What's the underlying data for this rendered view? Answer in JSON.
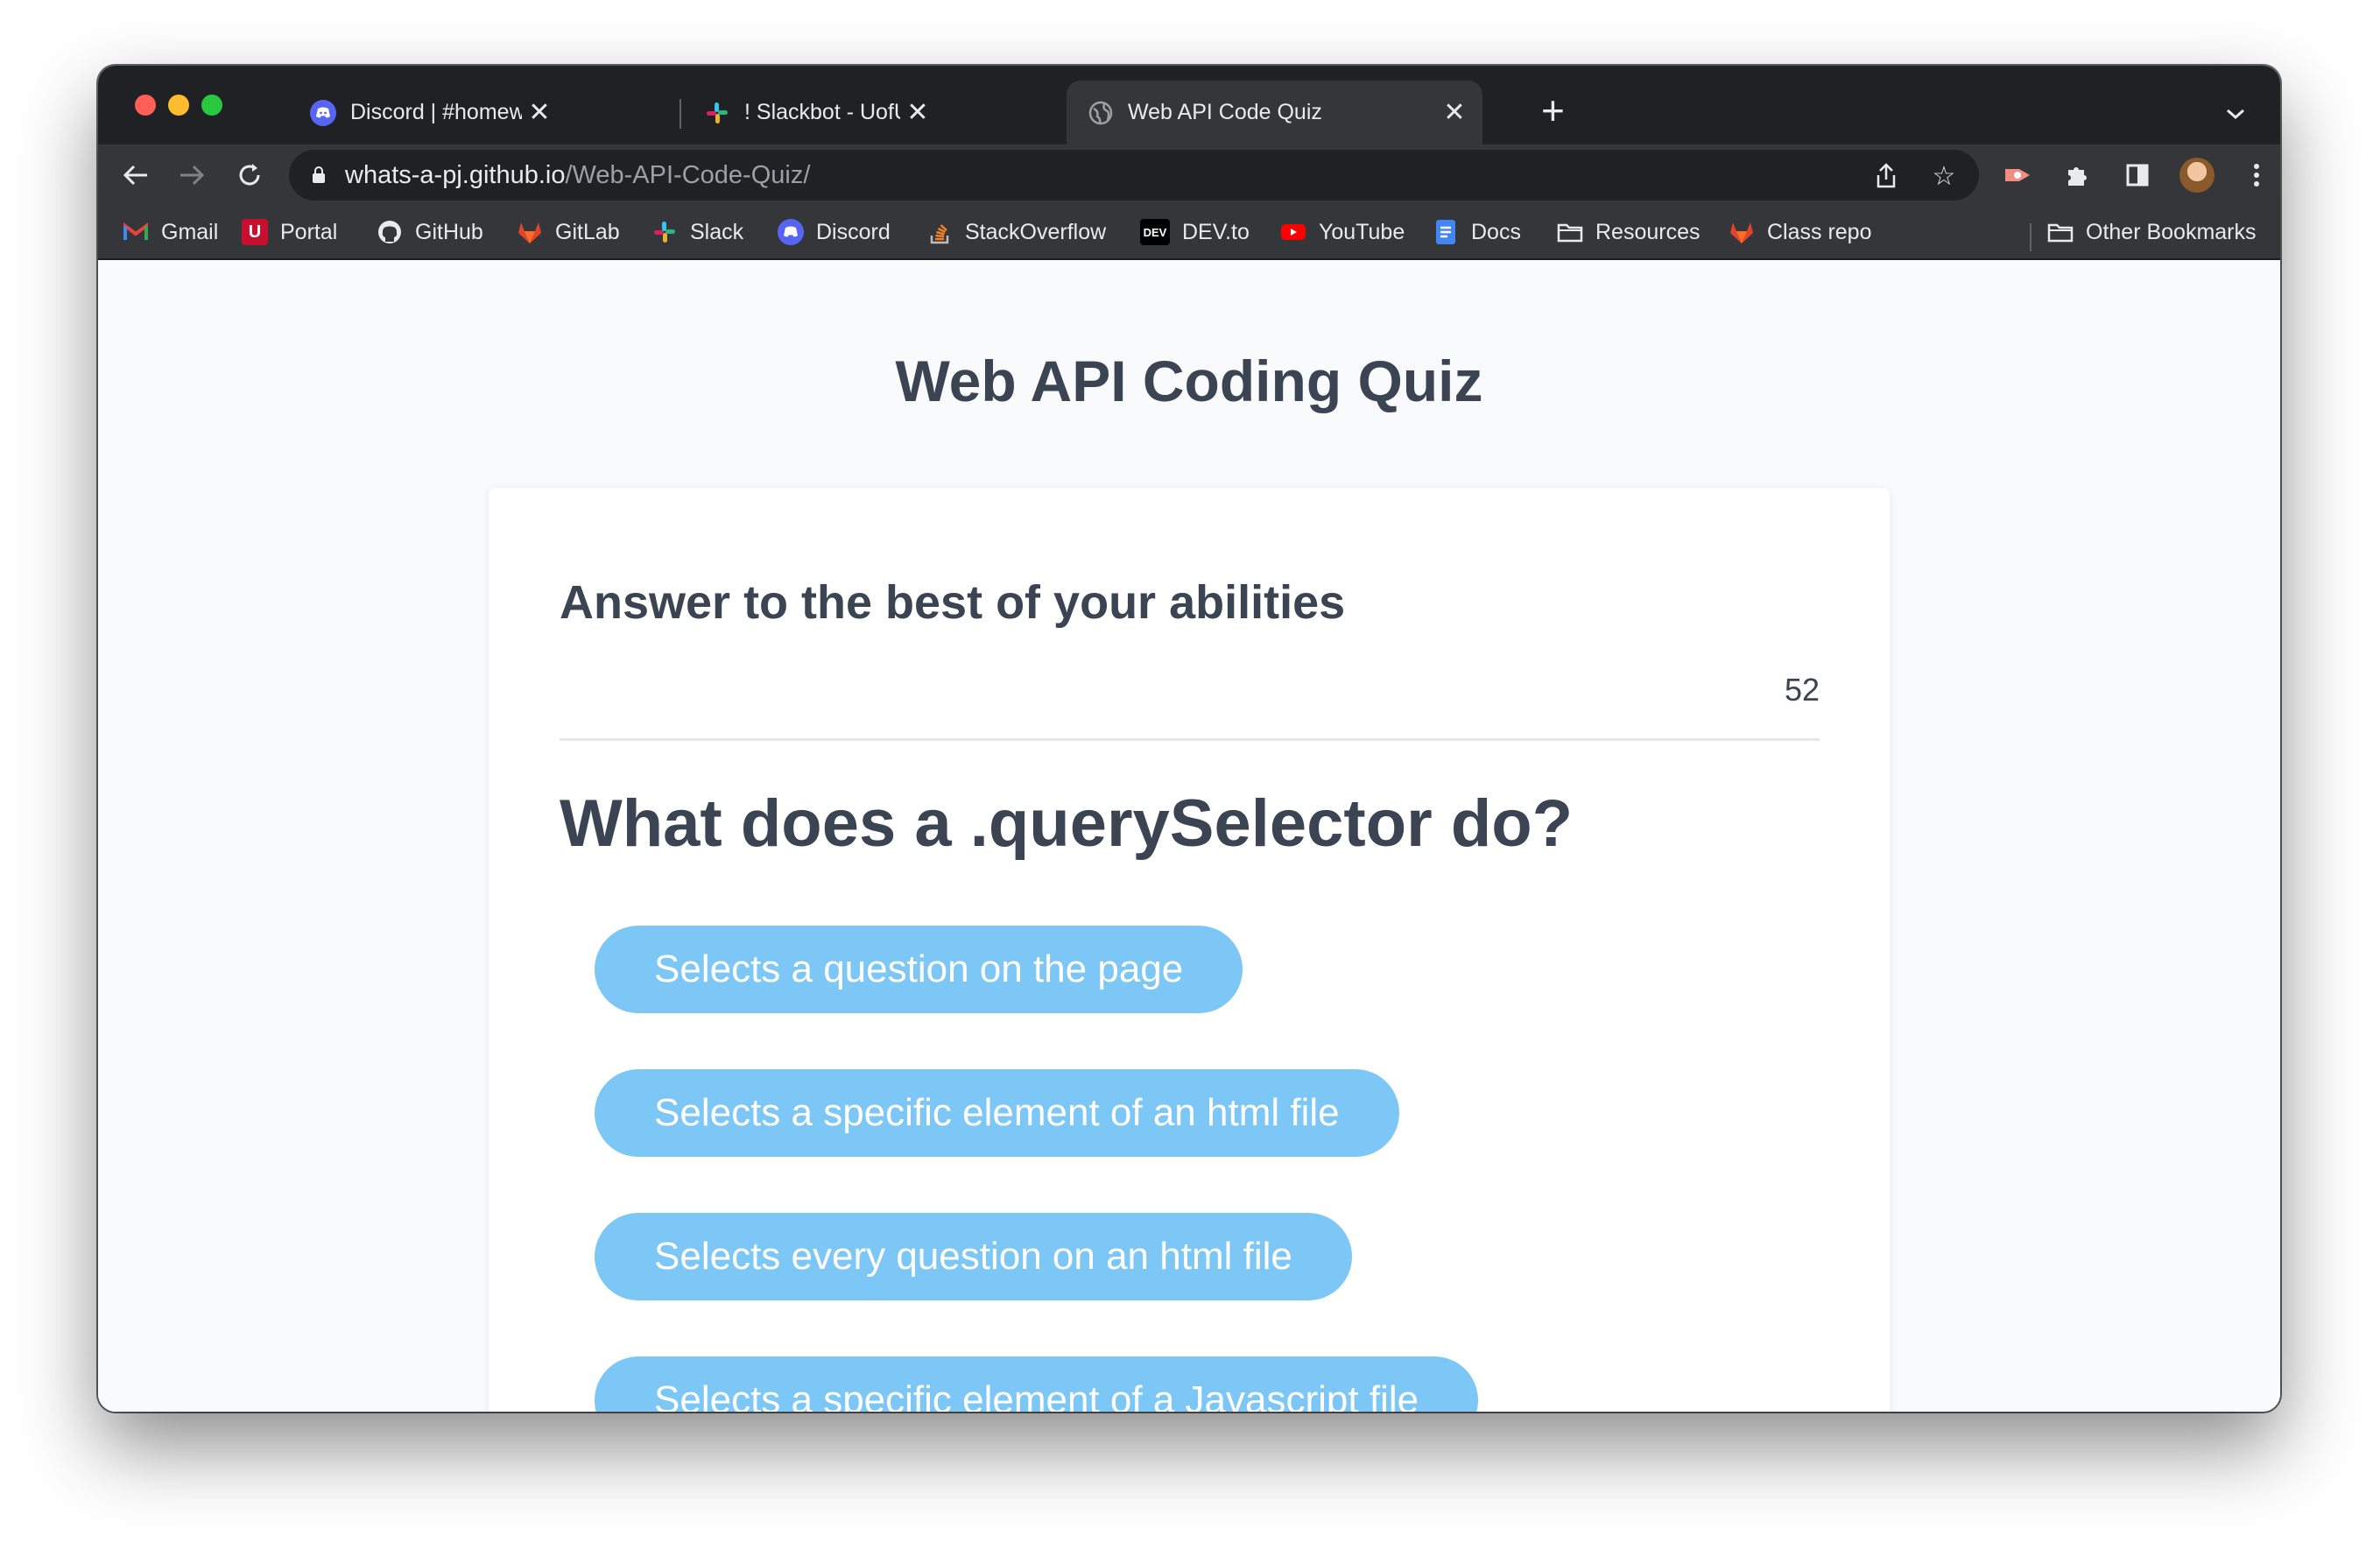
{
  "browser": {
    "tabs": [
      {
        "title": "Discord | #homework-help | Uo",
        "icon": "discord-icon",
        "active": false
      },
      {
        "title": "! Slackbot - UofU-VIRT-FSF-PT",
        "icon": "slack-icon",
        "active": false
      },
      {
        "title": "Web API Code Quiz",
        "icon": "globe-icon",
        "active": true
      }
    ],
    "address": {
      "host": "whats-a-pj.github.io",
      "path": "/Web-API-Code-Quiz/"
    },
    "bookmarks": [
      {
        "label": "Gmail",
        "icon": "gmail-icon",
        "color": "#ea4335"
      },
      {
        "label": "Portal",
        "icon": "portal-icon",
        "color": "#c8102e"
      },
      {
        "label": "GitHub",
        "icon": "github-icon",
        "color": "#ffffff"
      },
      {
        "label": "GitLab",
        "icon": "gitlab-icon",
        "color": "#e24329"
      },
      {
        "label": "Slack",
        "icon": "slack-icon",
        "color": "#36c5f0"
      },
      {
        "label": "Discord",
        "icon": "discord-icon",
        "color": "#5865f2"
      },
      {
        "label": "StackOverflow",
        "icon": "stackoverflow-icon",
        "color": "#f48024"
      },
      {
        "label": "DEV.to",
        "icon": "devto-icon",
        "color": "#000000"
      },
      {
        "label": "YouTube",
        "icon": "youtube-icon",
        "color": "#ff0000"
      },
      {
        "label": "Docs",
        "icon": "docs-icon",
        "color": "#4285f4"
      },
      {
        "label": "Resources",
        "icon": "folder-icon",
        "color": "#e8eaed"
      },
      {
        "label": "Class repo",
        "icon": "gitlab-icon",
        "color": "#e24329"
      }
    ],
    "other_bookmarks": "Other Bookmarks",
    "devto_glyph": "DEV"
  },
  "page": {
    "title": "Web API Coding Quiz",
    "subtitle": "Answer to the best of your abilities",
    "timer": "52",
    "question": "What does a .querySelector do?",
    "answers": [
      "Selects a question on the page",
      "Selects a specific element of an html file",
      "Selects every question on an html file",
      "Selects a specific element of a Javascript file"
    ],
    "colors": {
      "accent": "#7dc7f6",
      "text": "#3a4452",
      "background": "#f9fafb"
    }
  }
}
